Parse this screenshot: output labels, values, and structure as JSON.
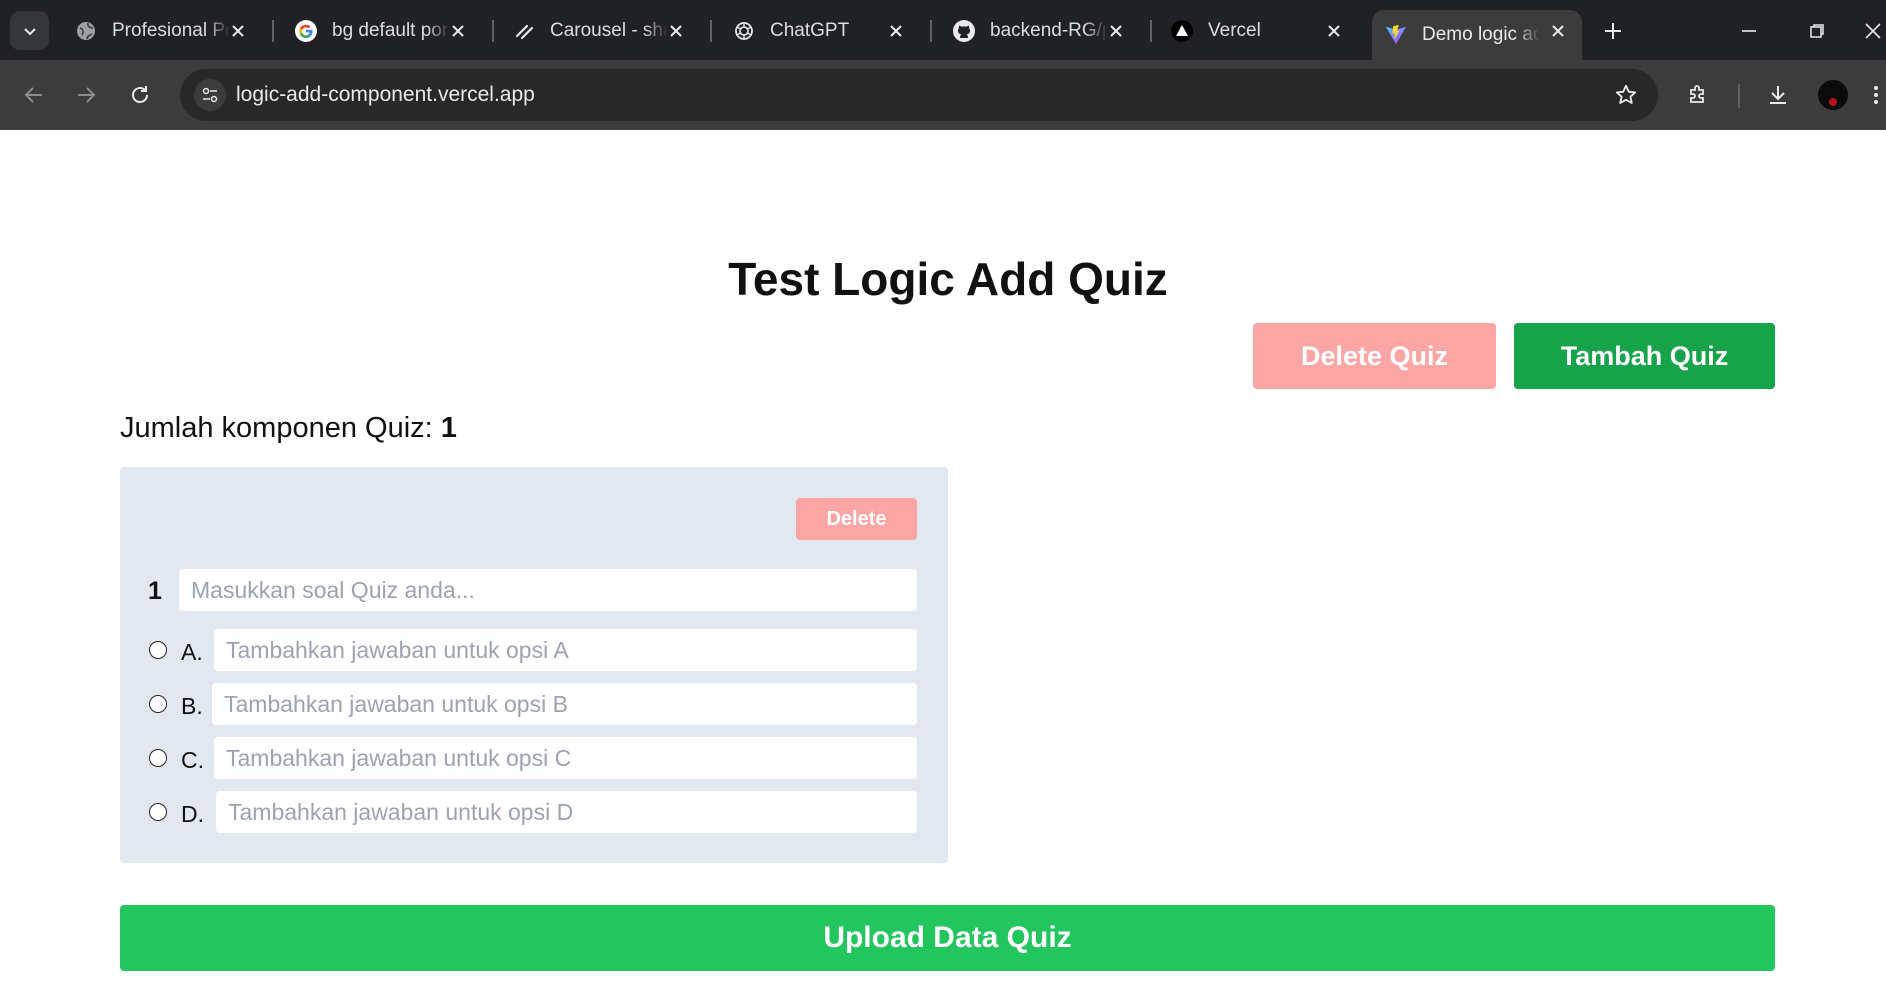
{
  "browser": {
    "tabs": [
      {
        "title": "Profesional Po",
        "favicon": "globe-icon"
      },
      {
        "title": "bg default por",
        "favicon": "google-g-icon"
      },
      {
        "title": "Carousel - sha",
        "favicon": "shadcn-icon"
      },
      {
        "title": "ChatGPT",
        "favicon": "openai-icon"
      },
      {
        "title": "backend-RG/p",
        "favicon": "github-icon"
      },
      {
        "title": "Vercel",
        "favicon": "vercel-triangle-icon"
      },
      {
        "title": "Demo logic ad",
        "favicon": "vite-icon",
        "active": true
      }
    ],
    "url": "logic-add-component.vercel.app"
  },
  "page": {
    "title": "Test Logic Add Quiz",
    "delete_quiz_label": "Delete Quiz",
    "add_quiz_label": "Tambah Quiz",
    "count_label": "Jumlah komponen Quiz:",
    "count_value": "1",
    "upload_label": "Upload Data Quiz"
  },
  "quiz": {
    "delete_label": "Delete",
    "number": "1",
    "question_placeholder": "Masukkan soal Quiz anda...",
    "options": [
      {
        "letter": "A.",
        "placeholder": "Tambahkan jawaban untuk opsi A"
      },
      {
        "letter": "B.",
        "placeholder": "Tambahkan jawaban untuk opsi B"
      },
      {
        "letter": "C.",
        "placeholder": "Tambahkan jawaban untuk opsi C"
      },
      {
        "letter": "D.",
        "placeholder": "Tambahkan jawaban untuk opsi D"
      }
    ]
  },
  "colors": {
    "delete_light": "#fca5a5",
    "add_green": "#16a34a",
    "upload_green": "#22c55e",
    "card_bg": "#e2e8f0"
  }
}
